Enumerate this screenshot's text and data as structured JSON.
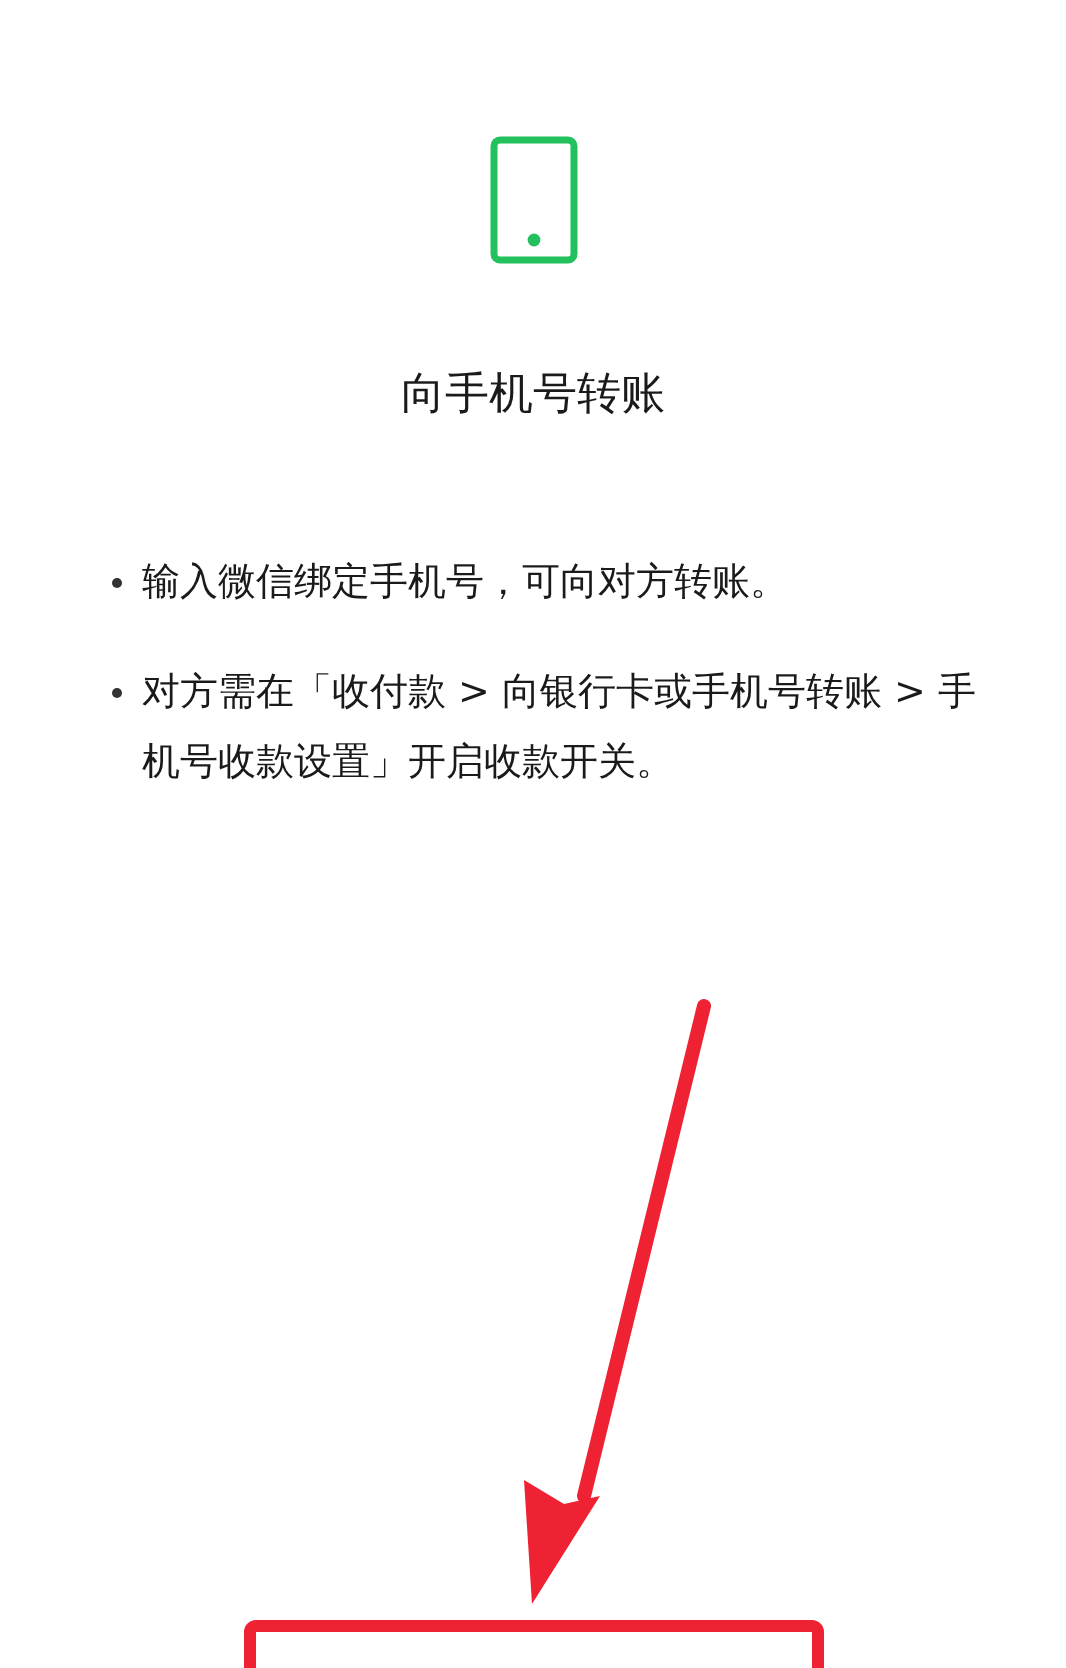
{
  "title": "向手机号转账",
  "notes": [
    "输入微信绑定手机号，可向对方转账。",
    "对方需在「收付款 > 向银行卡或手机号转账 > 手机号收款设置」开启收款开关。"
  ]
}
